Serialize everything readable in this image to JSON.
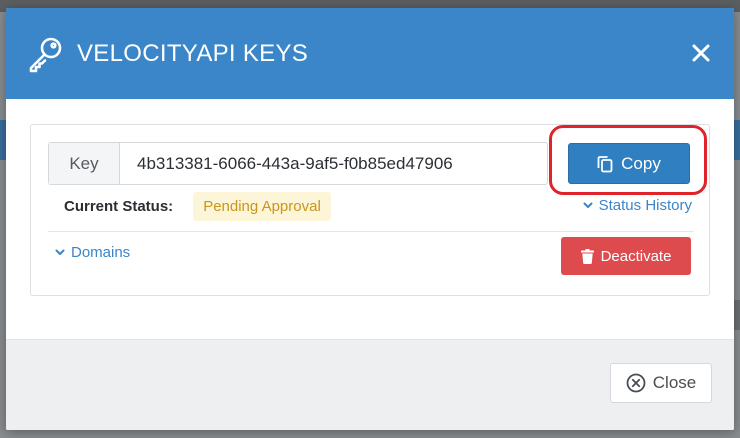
{
  "modal": {
    "title": "VELOCITYAPI KEYS",
    "header_color": "#3a86c8",
    "title_icon": "key-icon",
    "close_icon": "close-icon"
  },
  "key": {
    "label": "Key",
    "value": "4b313381-6066-443a-9af5-f0b85ed47906"
  },
  "copy_button": {
    "label": "Copy",
    "icon": "copy-icon",
    "highlight_color": "#e0232b"
  },
  "status": {
    "label": "Current Status:",
    "value": "Pending Approval",
    "badge_bg": "#fdf5d8",
    "badge_color": "#c9951a"
  },
  "status_history": {
    "label": "Status History",
    "icon": "chevron-down-icon"
  },
  "domains": {
    "label": "Domains",
    "icon": "chevron-down-icon"
  },
  "deactivate_button": {
    "label": "Deactivate",
    "icon": "trash-icon",
    "color": "#dd4b4e"
  },
  "footer": {
    "close_label": "Close",
    "close_icon": "circle-x-icon"
  }
}
